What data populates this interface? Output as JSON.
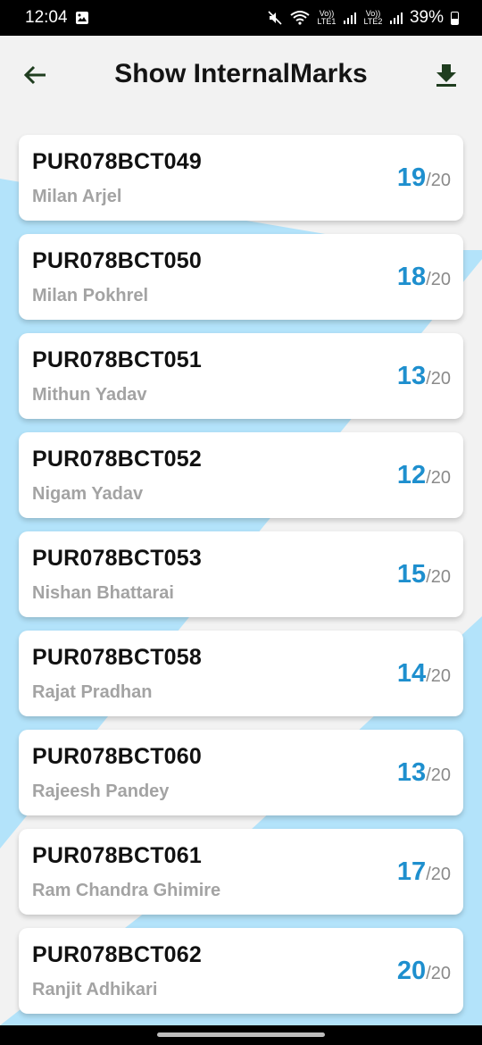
{
  "status_bar": {
    "time": "12:04",
    "lte1": "Vo)) LTE1",
    "lte2": "Vo)) LTE2",
    "battery": "39%"
  },
  "app_bar": {
    "title": "Show InternalMarks",
    "back_icon": "arrow-left-icon",
    "download_icon": "download-icon"
  },
  "colors": {
    "score": "#1e8fce",
    "decoration": "#b3e3fa",
    "icon": "#1f3d1f"
  },
  "students": [
    {
      "roll": "PUR078BCT049",
      "name": "Milan Arjel",
      "score": "19",
      "total": "/20"
    },
    {
      "roll": "PUR078BCT050",
      "name": "Milan Pokhrel",
      "score": "18",
      "total": "/20"
    },
    {
      "roll": "PUR078BCT051",
      "name": "Mithun Yadav",
      "score": "13",
      "total": "/20"
    },
    {
      "roll": "PUR078BCT052",
      "name": "Nigam Yadav",
      "score": "12",
      "total": "/20"
    },
    {
      "roll": "PUR078BCT053",
      "name": "Nishan Bhattarai",
      "score": "15",
      "total": "/20"
    },
    {
      "roll": "PUR078BCT058",
      "name": "Rajat Pradhan",
      "score": "14",
      "total": "/20"
    },
    {
      "roll": "PUR078BCT060",
      "name": "Rajeesh Pandey",
      "score": "13",
      "total": "/20"
    },
    {
      "roll": "PUR078BCT061",
      "name": "Ram Chandra Ghimire",
      "score": "17",
      "total": "/20"
    },
    {
      "roll": "PUR078BCT062",
      "name": "Ranjit Adhikari",
      "score": "20",
      "total": "/20"
    }
  ]
}
